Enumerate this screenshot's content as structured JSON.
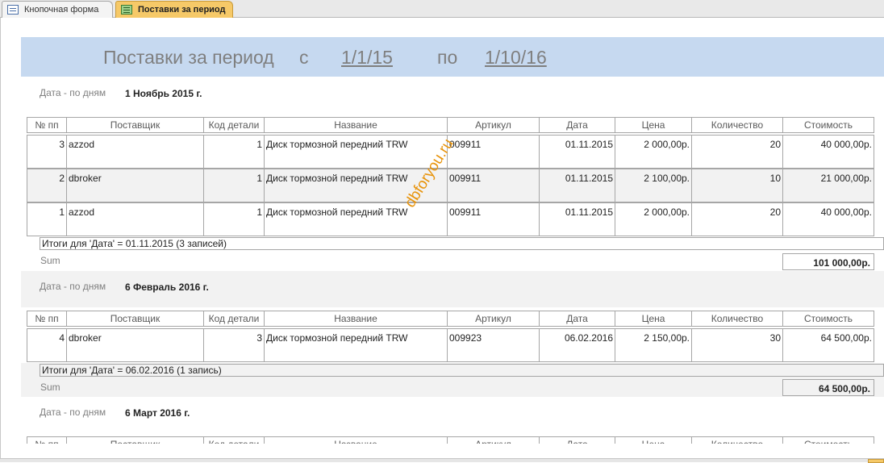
{
  "tabs": [
    {
      "label": "Кнопочная форма",
      "icon": "form-icon"
    },
    {
      "label": "Поставки за период",
      "icon": "report-icon"
    }
  ],
  "header": {
    "title": "Поставки за период",
    "from_label": "с",
    "from_date": "1/1/15",
    "to_label": "по",
    "to_date": "1/10/16"
  },
  "columns": [
    "№ пп",
    "Поставщик",
    "Код детали",
    "Название",
    "Артикул",
    "Дата",
    "Цена",
    "Количество",
    "Стоимость"
  ],
  "group_label": "Дата - по дням",
  "sum_label": "Sum",
  "watermark": "dbforyou.ru",
  "groups": [
    {
      "title": "1 Ноябрь 2015 г.",
      "rows": [
        [
          "3",
          "azzod",
          "1",
          "Диск тормозной передний TRW",
          "009911",
          "01.11.2015",
          "2 000,00р.",
          "20",
          "40 000,00р."
        ],
        [
          "2",
          "dbroker",
          "1",
          "Диск тормозной передний TRW",
          "009911",
          "01.11.2015",
          "2 100,00р.",
          "10",
          "21 000,00р."
        ],
        [
          "1",
          "azzod",
          "1",
          "Диск тормозной передний TRW",
          "009911",
          "01.11.2015",
          "2 000,00р.",
          "20",
          "40 000,00р."
        ]
      ],
      "summary": "Итоги для 'Дата' =  01.11.2015 (3 записей)",
      "sum": "101 000,00р."
    },
    {
      "title": "6 Февраль 2016 г.",
      "rows": [
        [
          "4",
          "dbroker",
          "3",
          "Диск тормозной передний TRW",
          "009923",
          "06.02.2016",
          "2 150,00р.",
          "30",
          "64 500,00р."
        ]
      ],
      "summary": "Итоги для 'Дата' =  06.02.2016 (1 запись)",
      "sum": "64 500,00р."
    },
    {
      "title": "6 Март 2016 г."
    }
  ]
}
